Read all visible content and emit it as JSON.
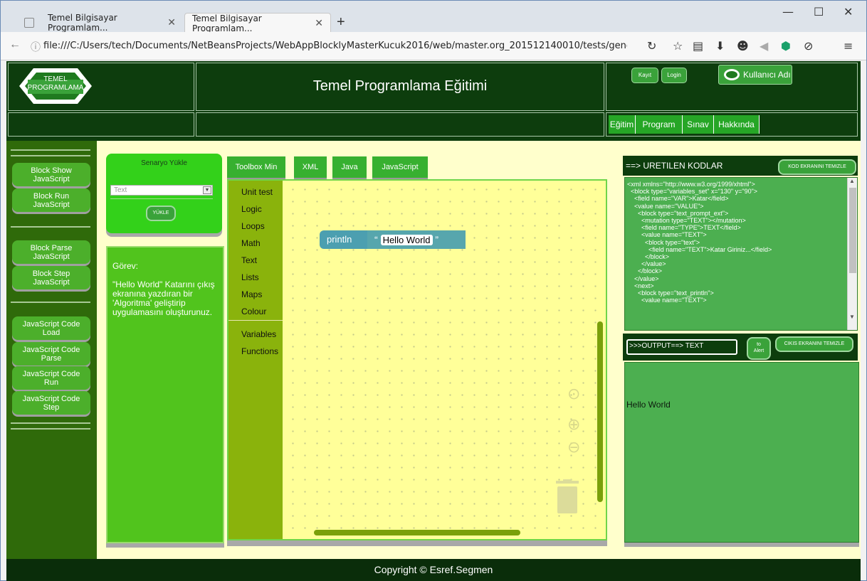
{
  "browser": {
    "tabs": [
      {
        "title": "Temel Bilgisayar Programlam...",
        "close": "✕"
      },
      {
        "title": "Temel Bilgisayar Programlam...",
        "close": "✕"
      }
    ],
    "new_tab": "+",
    "url": "file:///C:/Users/tech/Documents/NetBeansProjects/WebAppBlocklyMasterKucuk2016/web/master.org_201512140010/tests/generators20",
    "window_controls": {
      "minimize": "—",
      "maximize": "☐",
      "close": "✕"
    }
  },
  "header": {
    "logo_line1": "TEMEL",
    "logo_line2": "PROGRAMLAMA",
    "title": "Temel Programlama Eğitimi",
    "kayit": "Kayıt",
    "login": "Login",
    "user": "Kullanıcı Adı",
    "menu": [
      "Eğitim",
      "Program",
      "Sınav",
      "Hakkında"
    ]
  },
  "left_buttons": [
    [
      "Block Show",
      "JavaScript"
    ],
    [
      "Block Run",
      "JavaScript"
    ],
    [
      "Block Parse",
      "JavaScript"
    ],
    [
      "Block Step",
      "JavaScript"
    ],
    [
      "JavaScript Code",
      "Load"
    ],
    [
      "JavaScript Code",
      "Parse"
    ],
    [
      "JavaScript Code",
      "Run"
    ],
    [
      "JavaScript Code",
      "Step"
    ]
  ],
  "scenario": {
    "title": "Senaryo Yükle",
    "select_value": "Text",
    "load_button": "YÜKLE"
  },
  "task": {
    "label": "Görev:",
    "text": "\"Hello World\" Katarını çıkış ekranına yazdıran bir 'Algoritma' geliştirip uygulamasını oluşturunuz."
  },
  "toolbar": [
    "Toolbox Min",
    "XML",
    "Java",
    "JavaScript"
  ],
  "toolbox": [
    "Unit test",
    "Logic",
    "Loops",
    "Math",
    "Text",
    "Lists",
    "Maps",
    "Colour",
    "Variables",
    "Functions"
  ],
  "blocks": {
    "println": "println",
    "open_quote": "“",
    "string": "Hello World",
    "close_quote": "”"
  },
  "code_panel": {
    "title": "==> URETILEN KODLAR",
    "clear_button": "KOD EKRANINI TEMIZLE",
    "code": "<xml xmlns=\"http://www.w3.org/1999/xhtml\">\n  <block type=\"variables_set\" x=\"130\" y=\"90\">\n    <field name=\"VAR\">Katar</field>\n    <value name=\"VALUE\">\n      <block type=\"text_prompt_ext\">\n        <mutation type=\"TEXT\"></mutation>\n        <field name=\"TYPE\">TEXT</field>\n        <value name=\"TEXT\">\n          <block type=\"text\">\n            <field name=\"TEXT\">Katar Giriniz...</field>\n          </block>\n        </value>\n      </block>\n    </value>\n    <next>\n      <block type=\"text_println\">\n        <value name=\"TEXT\">"
  },
  "output": {
    "field_value": ">>>OUTPUT==> TEXT",
    "to_alert": [
      "to",
      "Alert"
    ],
    "clear_button": "CIKIS EKRANINI TEMIZLE",
    "text": "Hello World"
  },
  "footer": "Copyright © Esref.Segmen"
}
